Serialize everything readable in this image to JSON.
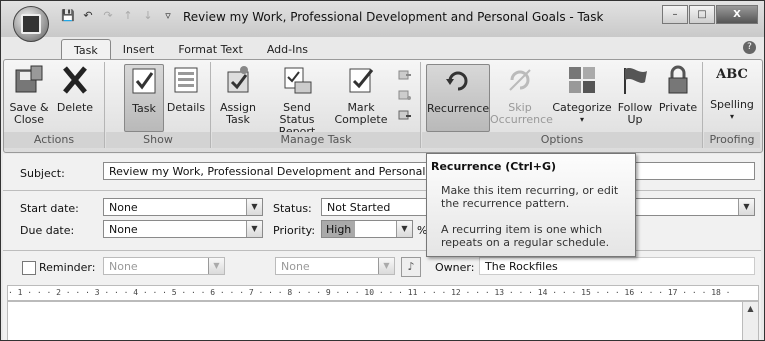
{
  "window": {
    "title": "Review my Work, Professional Development and Personal Goals - Task",
    "minimize_glyph": "–",
    "maximize_glyph": "□",
    "close_glyph": "X"
  },
  "quick_access": [
    {
      "icon": "save-icon",
      "glyph": "💾"
    },
    {
      "icon": "undo-icon",
      "glyph": "↶"
    },
    {
      "icon": "redo-icon",
      "glyph": "↷"
    },
    {
      "icon": "up-arrow-icon",
      "glyph": "↑"
    },
    {
      "icon": "down-arrow-icon",
      "glyph": "↓"
    },
    {
      "icon": "customize-icon",
      "glyph": "▿"
    }
  ],
  "tabs": [
    "Task",
    "Insert",
    "Format Text",
    "Add-Ins"
  ],
  "help_glyph": "?",
  "ribbon": {
    "groups": {
      "actions": "Actions",
      "show": "Show",
      "manage_task": "Manage Task",
      "options": "Options",
      "proofing": "Proofing"
    },
    "buttons": {
      "save_close": [
        "Save &",
        "Close"
      ],
      "delete": "Delete",
      "task": "Task",
      "details": "Details",
      "assign_task": [
        "Assign",
        "Task"
      ],
      "send_status_report": [
        "Send Status",
        "Report"
      ],
      "mark_complete": [
        "Mark",
        "Complete"
      ],
      "recurrence": "Recurrence",
      "skip_occurrence": [
        "Skip",
        "Occurrence"
      ],
      "categorize": "Categorize",
      "follow_up": "Follow",
      "follow_up_2": "Up",
      "private": "Private",
      "spelling": "Spelling",
      "spelling_glyph": "ABC"
    }
  },
  "form": {
    "subject_label": "Subject:",
    "subject_value": "Review my Work, Professional Development and Personal Goals",
    "start_date_label": "Start date:",
    "start_date_value": "None",
    "due_date_label": "Due date:",
    "due_date_value": "None",
    "status_label": "Status:",
    "status_value": "Not Started",
    "priority_label": "Priority:",
    "priority_value": "High",
    "percent_fragment": "%",
    "reminder_label": "Reminder:",
    "reminder_date": "None",
    "reminder_time": "None",
    "owner_label": "Owner:",
    "owner_value": "The Rockfiles"
  },
  "ruler_text": "· 1 · · · 2 · · · 3 · · · 4 · · · 5 · · · 6 · · · 7 · · · 8 · · · 9 · · · 10 · · · 11 · · · 12 · · · 13 · · · 14 · · · 15 · · · 16 · · · 17 · · · 18 ·",
  "tooltip": {
    "title": "Recurrence (Ctrl+G)",
    "line1": "Make this item recurring, or edit",
    "line2": "the recurrence pattern.",
    "line3": "A recurring item is one which",
    "line4": "repeats on a regular schedule."
  }
}
